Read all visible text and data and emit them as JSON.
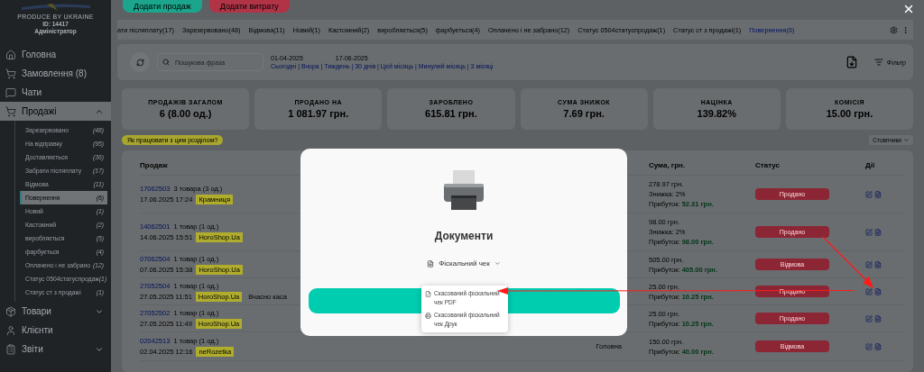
{
  "top_buttons": [
    {
      "label": "Додати продаж",
      "kind": "sale"
    },
    {
      "label": "Додати витрату",
      "kind": "expense"
    }
  ],
  "sidebar": {
    "tagline": "PRODUCE BY UKRAINE",
    "user_id": "ID: 14417",
    "role": "Адміністратор",
    "items": [
      {
        "label": "Головна",
        "selected": false
      },
      {
        "label": "Замовлення (8)",
        "selected": false
      },
      {
        "label": "Чати",
        "selected": false
      },
      {
        "label": "Продажі",
        "selected": true,
        "expanded": true,
        "children": [
          {
            "label": "Зарезервовано",
            "count": "(48)",
            "selected": false
          },
          {
            "label": "На відправку",
            "count": "(95)",
            "selected": false
          },
          {
            "label": "Доставляється",
            "count": "(36)",
            "selected": false
          },
          {
            "label": "Забрати післяплату",
            "count": "(17)",
            "selected": false
          },
          {
            "label": "Відмова",
            "count": "(11)",
            "selected": false
          },
          {
            "label": "Повернення",
            "count": "(6)",
            "selected": true
          },
          {
            "label": "Новий",
            "count": "(1)",
            "selected": false
          },
          {
            "label": "Кастомний",
            "count": "(2)",
            "selected": false
          },
          {
            "label": "виробляється",
            "count": "(5)",
            "selected": false
          },
          {
            "label": "фарбується",
            "count": "(4)",
            "selected": false
          },
          {
            "label": "Оплачено і не забрано",
            "count": "(12)",
            "selected": false
          },
          {
            "label": "Статус 0504статуспродаж",
            "count": "(1)",
            "selected": false
          },
          {
            "label": "Статус ст з продажі",
            "count": "(1)",
            "selected": false
          }
        ]
      },
      {
        "label": "Товари",
        "selected": false,
        "expanded": false
      },
      {
        "label": "Клієнти",
        "selected": false
      },
      {
        "label": "Звіти",
        "selected": false,
        "expanded": false
      }
    ]
  },
  "tabs": [
    {
      "label": "ати післяплату(17)",
      "selected": false
    },
    {
      "label": "Зарезервовано(48)",
      "selected": false
    },
    {
      "label": "Відмова(11)",
      "selected": false
    },
    {
      "label": "Новий(1)",
      "selected": false
    },
    {
      "label": "Кастомний(2)",
      "selected": false
    },
    {
      "label": "виробляється(5)",
      "selected": false
    },
    {
      "label": "фарбується(4)",
      "selected": false
    },
    {
      "label": "Оплачено і не забрано(12)",
      "selected": false
    },
    {
      "label": "Статус 0504статуспродаж(1)",
      "selected": false
    },
    {
      "label": "Статус ст з продажі(1)",
      "selected": false
    },
    {
      "label": "Повернення(6)",
      "selected": true
    }
  ],
  "filters": {
    "search_placeholder": "Пошукова фраза",
    "date_from": "01-04-2025",
    "date_to": "17-06-2025",
    "quick_ranges": "Сьогодні | Вчора | Тиждень | 30 днів | Цей місяць | Минулий місяць | 3 місяці",
    "filter_label": "Фільтр"
  },
  "stats": [
    {
      "label": "ПРОДАЖІВ ЗАГАЛОМ",
      "value": "6 (8.00 од.)"
    },
    {
      "label": "ПРОДАНО НА",
      "value": "1 081.97 грн."
    },
    {
      "label": "ЗАРОБЛЕНО",
      "value": "615.81 грн."
    },
    {
      "label": "СУМА ЗНИЖОК",
      "value": "7.69 грн."
    },
    {
      "label": "НАЦІНКА",
      "value": "139.82%"
    },
    {
      "label": "КОМІСІЯ",
      "value": "15.00 грн."
    }
  ],
  "help_link": "Як працювати з цим розділом?",
  "columns_button": "Стовпчики",
  "table": {
    "columns": [
      "Продаж",
      "Сума, грн.",
      "Статус",
      "Дії"
    ],
    "rows": [
      {
        "order": "17062503",
        "items": "3 товара (3 од.)",
        "date": "17.06.2025 17:24",
        "source": "Крамниця",
        "sum": "278.97 грн.",
        "discount": "Знижка: 2%",
        "profit_label": "Прибуток:",
        "profit": "52.31 грн.",
        "status": "Продано"
      },
      {
        "order": "14062501",
        "items": "1 товар (1 од.)",
        "date": "14.06.2025 15:51",
        "source": "HoroShop.Ua",
        "sum": "98.00 грн.",
        "discount": "Знижка: 2%",
        "profit_label": "Прибуток:",
        "profit": "98.00 грн.",
        "status": "Продано"
      },
      {
        "order": "07062504",
        "items": "1 товар (1 од.)",
        "date": "07.06.2025 15:38",
        "source": "HoroShop.Ua",
        "sum": "505.00 грн.",
        "profit_label": "Прибуток:",
        "profit": "405.00 грн.",
        "status": "Відмова"
      },
      {
        "order": "27052504",
        "items": "1 товар (1 од.)",
        "date": "27.05.2025 11:51",
        "source": "HoroShop.Ua",
        "note": "Вчасно каса",
        "sum": "25.00 грн.",
        "profit_label": "Прибуток:",
        "profit": "10.25 грн.",
        "status": "Продано"
      },
      {
        "order": "27052502",
        "items": "1 товар (1 од.)",
        "date": "27.05.2025 11:49",
        "source": "HoroShop.Ua",
        "sum": "25.00 грн.",
        "profit_label": "Прибуток:",
        "profit": "10.25 грн.",
        "status": "Продано"
      },
      {
        "order": "02042513",
        "items": "1 товар (1 од.)",
        "date": "02.04.2025 12:16",
        "source": "neRozetka",
        "column_2": "Головна",
        "sum": "150.00 грн.",
        "profit_label": "Прибуток:",
        "profit": "40.00 грн.",
        "status": "Відмова"
      }
    ]
  },
  "modal": {
    "title": "Документи",
    "document_select": "Фіскальний чек",
    "menu": [
      {
        "label": "Скасований фіскальний чек PDF",
        "kind": "pdf"
      },
      {
        "label": "Скасований фіскальний чек Друк",
        "kind": "print"
      }
    ]
  }
}
